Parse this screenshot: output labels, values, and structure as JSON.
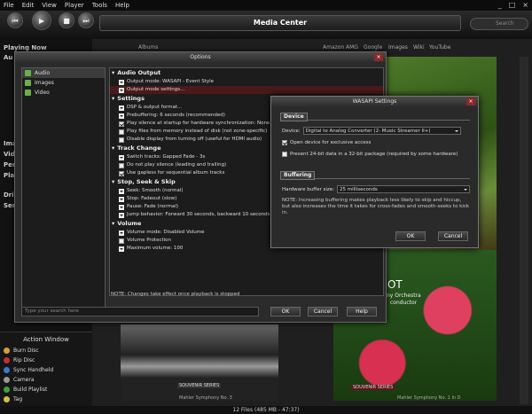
{
  "menu": [
    "File",
    "Edit",
    "View",
    "Player",
    "Tools",
    "Help"
  ],
  "window_controls": [
    "_",
    "□",
    "×"
  ],
  "transport": {
    "prev": "⏮",
    "play": "▶",
    "stop": "■",
    "next": "⏭"
  },
  "app_title": "Media Center",
  "search_placeholder": "Search",
  "left_nav": {
    "playing_now": "Playing Now",
    "audio": "Au",
    "images": "Ima",
    "video": "Vid",
    "performers": "Per",
    "playlists": "Pla",
    "drives": "Dri",
    "services": "Ser"
  },
  "tabs": {
    "albums": "Albums",
    "amazon": "Amazon",
    "amg": "AMG",
    "google": "Google",
    "images": "Images",
    "wiki": "Wiki",
    "youtube": "YouTube"
  },
  "action_window": {
    "title": "Action Window",
    "items": [
      "Burn Disc",
      "Rip Disc",
      "Sync Handheld",
      "Camera",
      "Build Playlist",
      "Tag"
    ]
  },
  "album_labels": {
    "souvenir_left": "SOUVENIR SERIES",
    "souvenir_right": "SOUVENIR SERIES",
    "mahler_left": "Mahler Symphony No. 3",
    "mahler_right": "Mahler Symphony No. 1 In D",
    "not_text": "NOT",
    "orchestra": "ny Orchestra",
    "conductor": "conductor"
  },
  "status": "12 Files (485 MB - 47:37)",
  "options": {
    "title": "Options",
    "categories": [
      "Audio",
      "Images",
      "Video"
    ],
    "sections": [
      {
        "name": "Audio Output",
        "rows": [
          {
            "type": "dd",
            "label": "Output mode: WASAPI - Event Style"
          },
          {
            "type": "dd",
            "label": "Output mode settings...",
            "highlight": true
          }
        ]
      },
      {
        "name": "Settings",
        "rows": [
          {
            "type": "dd",
            "label": "DSP & output format..."
          },
          {
            "type": "dd",
            "label": "Prebuffering: 6 seconds (recommended)"
          },
          {
            "type": "chk",
            "on": true,
            "label": "Play silence at startup for hardware synchronization: None"
          },
          {
            "type": "chk",
            "on": false,
            "label": "Play files from memory instead of disk (not zone-specific)"
          },
          {
            "type": "chk",
            "on": false,
            "label": "Disable display from turning off (useful for HDMI audio)"
          }
        ]
      },
      {
        "name": "Track Change",
        "rows": [
          {
            "type": "dd",
            "label": "Switch tracks: Gapped Fade - 3s"
          },
          {
            "type": "chk",
            "on": false,
            "label": "Do not play silence (leading and trailing)"
          },
          {
            "type": "chk",
            "on": true,
            "label": "Use gapless for sequential album tracks"
          }
        ]
      },
      {
        "name": "Stop, Seek & Skip",
        "rows": [
          {
            "type": "dd",
            "label": "Seek: Smooth (normal)"
          },
          {
            "type": "dd",
            "label": "Stop: Fadeout (slow)"
          },
          {
            "type": "dd",
            "label": "Pause: Fade (normal)"
          },
          {
            "type": "dd",
            "label": "Jump behavior: Forward 30 seconds, backward 10 seconds"
          }
        ]
      },
      {
        "name": "Volume",
        "rows": [
          {
            "type": "dd",
            "label": "Volume mode: Disabled Volume"
          },
          {
            "type": "chk",
            "on": false,
            "label": "Volume Protection"
          },
          {
            "type": "dd",
            "label": "Maximum volume: 100"
          }
        ]
      }
    ],
    "note": "NOTE: Changes take effect once playback is stopped",
    "search_placeholder": "Type your search here",
    "ok": "OK",
    "cancel": "Cancel",
    "help": "Help"
  },
  "wasapi": {
    "title": "WASAPI Settings",
    "device_group": "Device",
    "device_label": "Device:",
    "device_value": "Digital to Analog Converter (2- Music Streamer II+)",
    "exclusive": "Open device for exclusive access",
    "present24": "Present 24-bit data in a 32-bit package (required by some hardware)",
    "buffering_group": "Buffering",
    "buffer_label": "Hardware buffer size:",
    "buffer_value": "25 milliseconds",
    "note": "NOTE: Increasing buffering makes playback less likely to skip and hiccup, but also increases the time it takes for cross-fades and smooth-seeks to kick in.",
    "ok": "OK",
    "cancel": "Cancel"
  },
  "colors": {
    "accent_green": "#6ab04a",
    "highlight_red": "#4a1a1a",
    "close_red": "#8a2a2a"
  }
}
